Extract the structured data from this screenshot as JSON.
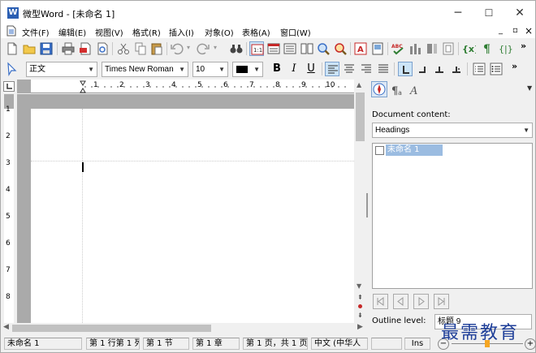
{
  "window": {
    "title": "微型Word - [未命名 1]",
    "app_icon_letter": "W",
    "controls": {
      "minimize": "─",
      "maximize": "☐",
      "close": "✕"
    }
  },
  "menubar": {
    "items": [
      "文件(F)",
      "编辑(E)",
      "视图(V)",
      "格式(R)",
      "插入(I)",
      "对象(O)",
      "表格(A)",
      "窗口(W)"
    ],
    "mdi_controls": {
      "minimize": "_",
      "restore": "▫",
      "close": "×"
    }
  },
  "format_bar": {
    "style_value": "正文",
    "font_value": "Times New Roman",
    "size_value": "10",
    "color": "#000000",
    "bold": "B",
    "italic": "I",
    "underline": "U"
  },
  "ruler": {
    "marks": [
      "1",
      "2",
      "3",
      "4",
      "5",
      "6",
      "7",
      "8",
      "9",
      "10"
    ]
  },
  "vruler": {
    "marks": [
      "1",
      "2",
      "3",
      "4",
      "5",
      "6",
      "7",
      "8"
    ]
  },
  "side_panel": {
    "content_label": "Document content:",
    "content_select": "Headings",
    "tree_item": "未命名 1",
    "outline_label": "Outline level:",
    "outline_value": "标题 9"
  },
  "statusbar": {
    "document_name": "未命名 1",
    "position": "第 1 行第 1 列",
    "section": "第 1 节",
    "chapter": "第 1 章",
    "pages": "第 1 页，共 1 页",
    "language": "中文 (中华人",
    "mode": "Ins"
  },
  "watermark": "最需教育",
  "colors": {
    "accent": "#2b5fb3",
    "selection": "#9bbce1",
    "doc_background": "#aaaaaa",
    "watermark": "#1f3f99"
  }
}
